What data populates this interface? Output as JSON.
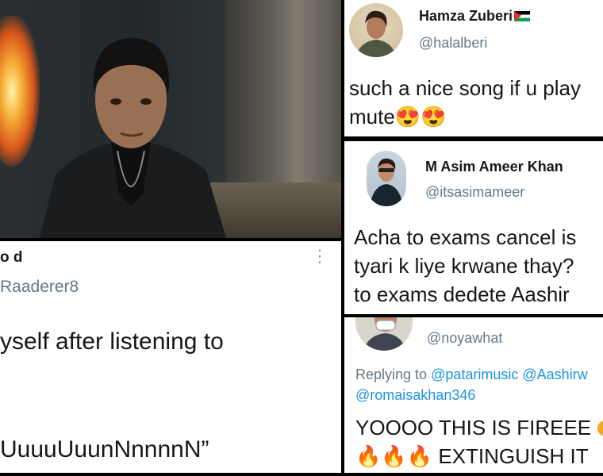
{
  "tweet_hamza": {
    "name": "Hamza Zuberi",
    "handle": "@halalberi",
    "text_line1": "such a nice song if u play",
    "text_line2": "mute",
    "emoji": "😍😍"
  },
  "tweet_asim": {
    "name": "M Asim Ameer Khan",
    "handle": "@itsasimameer",
    "text_line1": "Acha to exams cancel is",
    "text_line2": "tyari k liye krwane thay?",
    "text_line3": "to exams dedete Aashir"
  },
  "tweet_noya": {
    "handle": "@noyawhat",
    "replying_prefix": "Replying to ",
    "replying_mentions_1": "@patarimusic @Aashirw",
    "replying_mentions_2": "@romaisakhan346",
    "text_line1": "YOOOO THIS IS FIREEE",
    "text_line2_emoji": "🔥🔥🔥",
    "text_line2": " EXTINGUISH IT"
  },
  "tweet_raaderer": {
    "name_partial": "o d",
    "handle": "Raaderer8",
    "more_icon": "⋮",
    "text_line1": "yself after listening to",
    "text_line3": "UuuuUuunNnnnnN”"
  },
  "colors": {
    "handle": "#657786",
    "text": "#14171a",
    "link": "#1b95e0"
  }
}
